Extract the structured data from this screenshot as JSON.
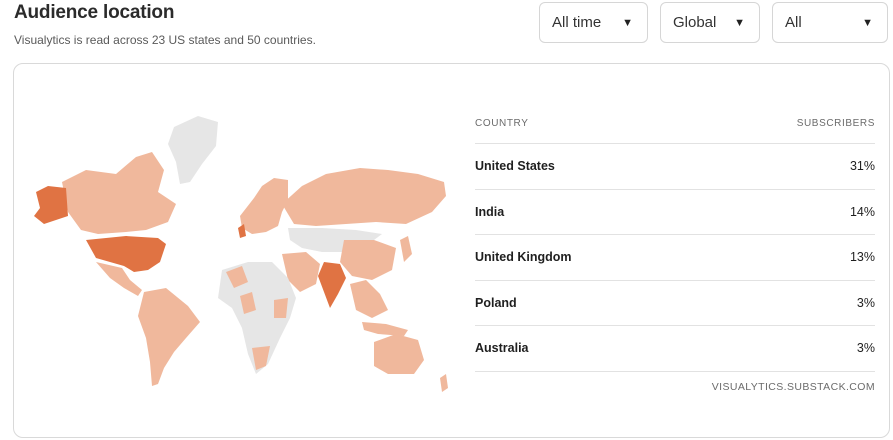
{
  "header": {
    "title": "Audience location",
    "subtitle": "Visualytics is read across 23 US states and 50 countries."
  },
  "filters": {
    "time": "All time",
    "region": "Global",
    "audience": "All"
  },
  "table": {
    "col_country": "COUNTRY",
    "col_subscribers": "SUBSCRIBERS",
    "rows": [
      {
        "country": "United States",
        "value": "31%"
      },
      {
        "country": "India",
        "value": "14%"
      },
      {
        "country": "United Kingdom",
        "value": "13%"
      },
      {
        "country": "Poland",
        "value": "3%"
      },
      {
        "country": "Australia",
        "value": "3%"
      }
    ]
  },
  "footer": "VISUALYTICS.SUBSTACK.COM",
  "colors": {
    "no_subscribers": "#e6e6e6",
    "low": "#f0b89c",
    "high": "#e07343"
  },
  "icons": {
    "dropdown": "caret-down-icon"
  }
}
